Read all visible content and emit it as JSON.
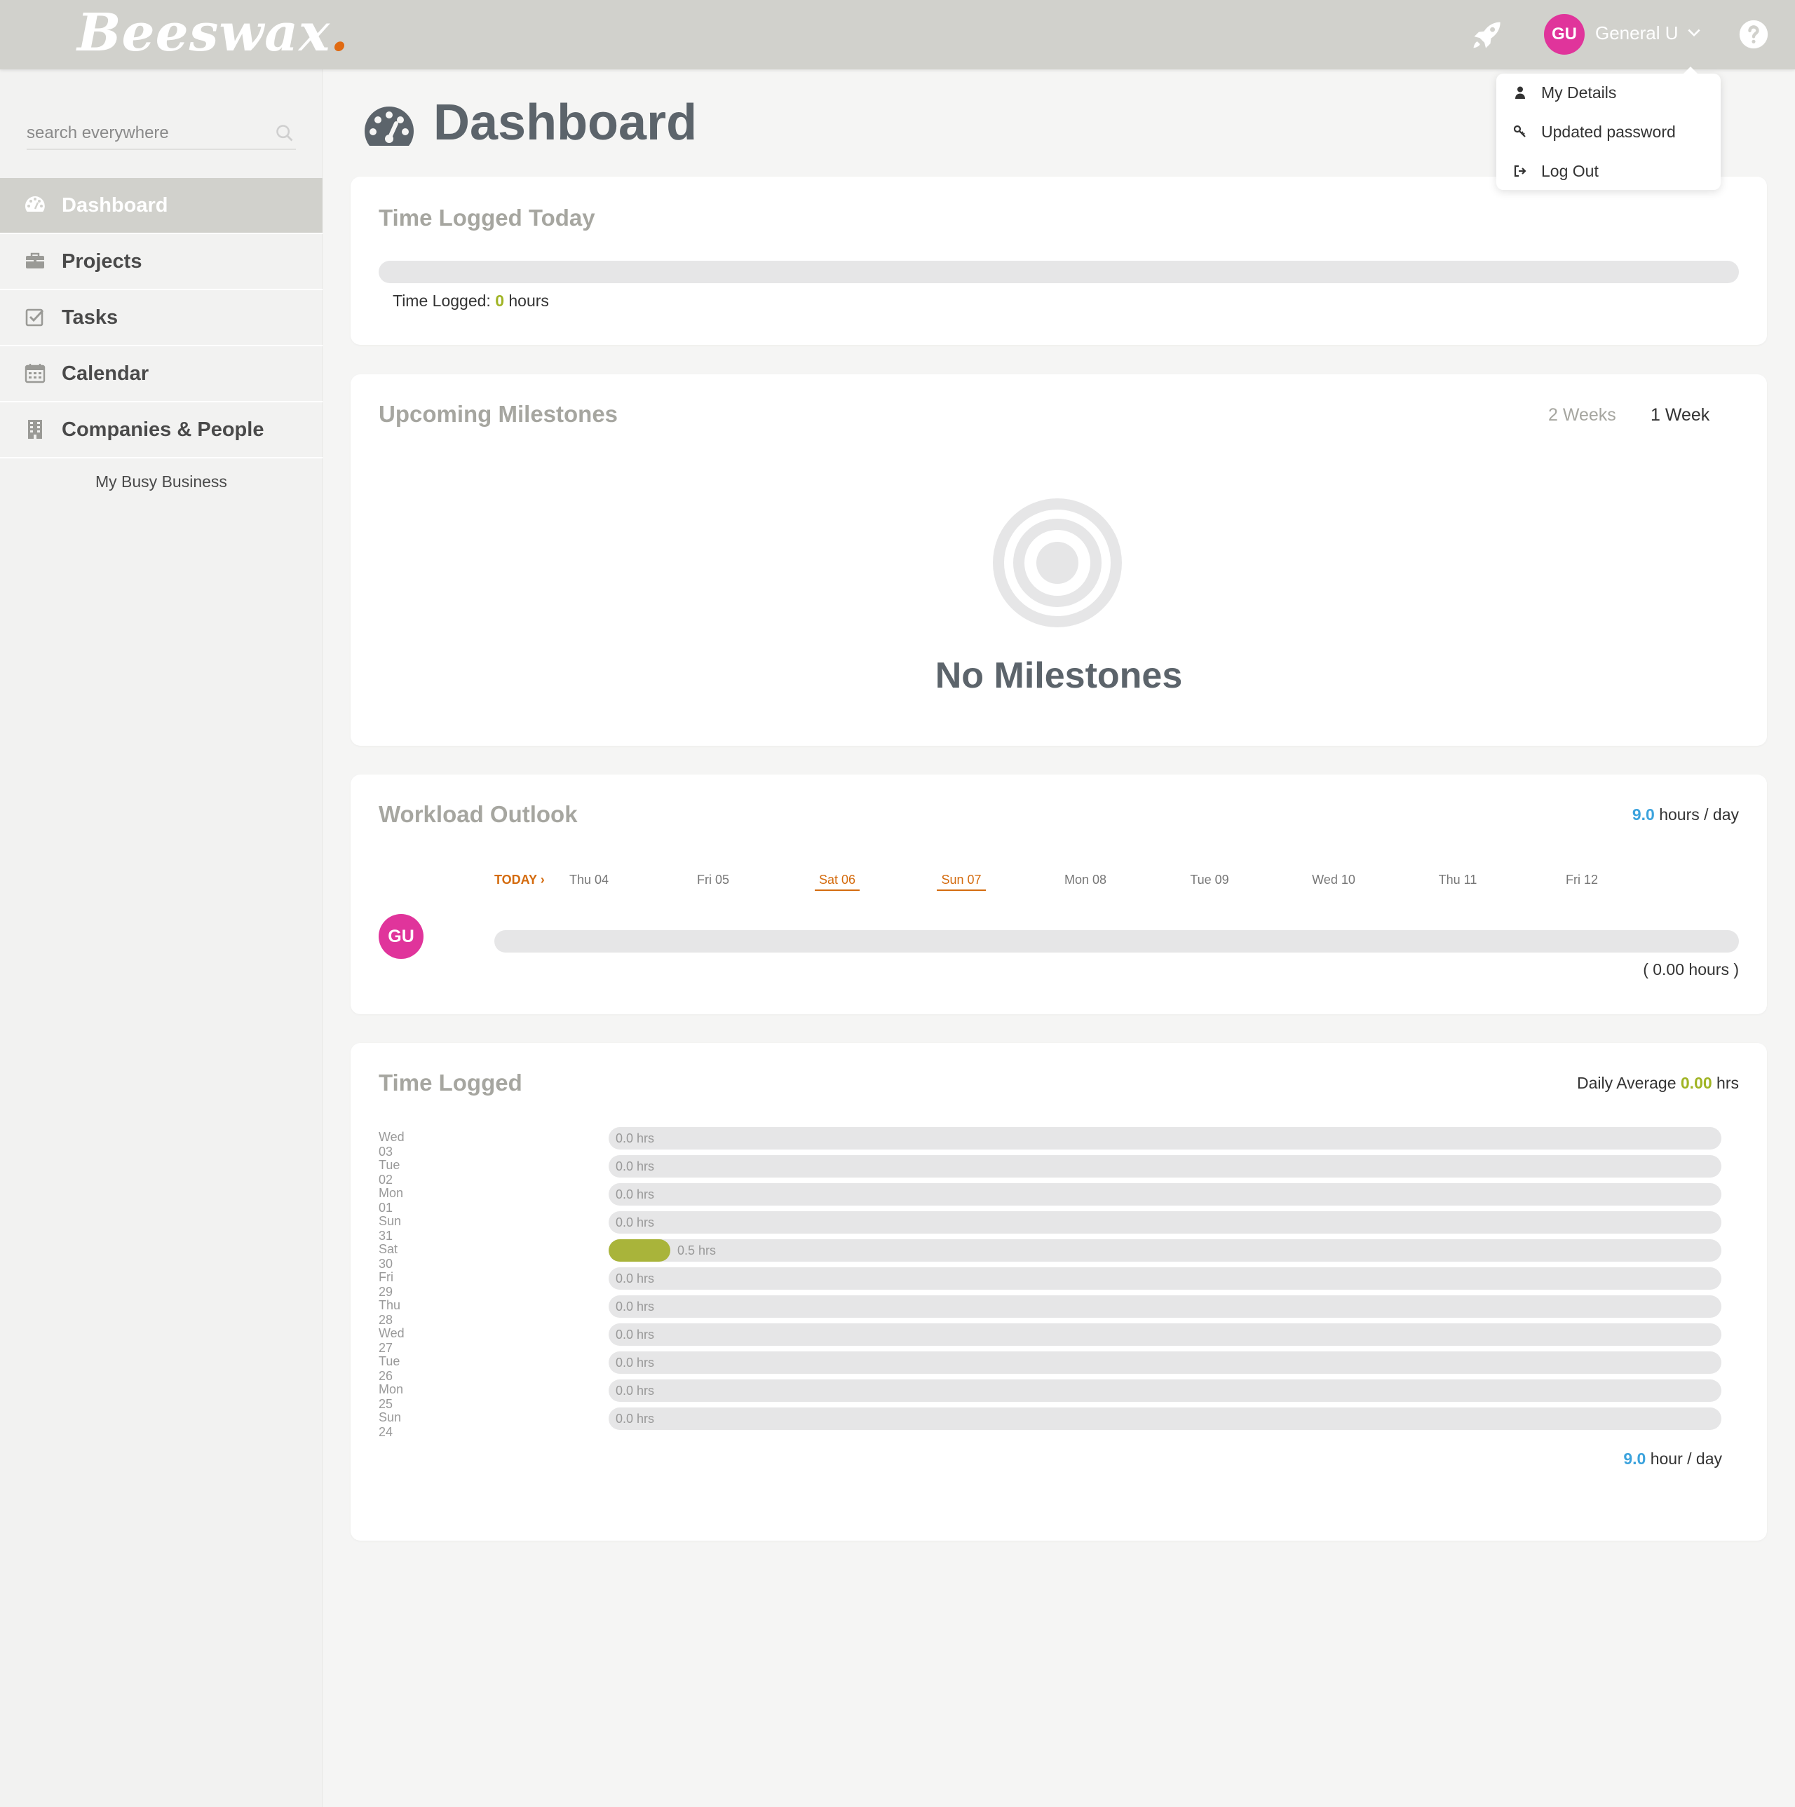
{
  "app": {
    "logo_text": "Beeswax",
    "logo_dot": "."
  },
  "topbar": {
    "user_initials": "GU",
    "user_name": "General U",
    "icons": [
      "rocket-icon",
      "chevron-down-icon",
      "help-icon"
    ]
  },
  "user_menu": {
    "items": [
      {
        "label": "My Details",
        "icon": "user-icon"
      },
      {
        "label": "Updated password",
        "icon": "key-icon"
      },
      {
        "label": "Log Out",
        "icon": "logout-icon"
      }
    ]
  },
  "sidebar": {
    "search_placeholder": "search everywhere",
    "items": [
      {
        "label": "Dashboard",
        "icon": "dashboard-icon",
        "active": true
      },
      {
        "label": "Projects",
        "icon": "briefcase-icon",
        "active": false
      },
      {
        "label": "Tasks",
        "icon": "checkbox-icon",
        "active": false
      },
      {
        "label": "Calendar",
        "icon": "calendar-icon",
        "active": false
      },
      {
        "label": "Companies & People",
        "icon": "building-icon",
        "active": false
      }
    ],
    "sub_item": "My Busy Business"
  },
  "page": {
    "title": "Dashboard"
  },
  "time_logged_today": {
    "title": "Time Logged Today",
    "label": "Time Logged:",
    "value": "0",
    "unit": "hours",
    "progress_fraction": 0
  },
  "milestones": {
    "title": "Upcoming Milestones",
    "ranges": [
      {
        "label": "2 Weeks",
        "selected": false
      },
      {
        "label": "1 Week",
        "selected": true
      }
    ],
    "empty_text": "No Milestones"
  },
  "workload": {
    "title": "Workload Outlook",
    "capacity_value": "9.0",
    "capacity_unit": "hours / day",
    "today_label": "TODAY",
    "days": [
      {
        "label": "Thu 04",
        "weekend": false
      },
      {
        "label": "Fri 05",
        "weekend": false
      },
      {
        "label": "Sat 06",
        "weekend": true
      },
      {
        "label": "Sun 07",
        "weekend": true
      },
      {
        "label": "Mon 08",
        "weekend": false
      },
      {
        "label": "Tue 09",
        "weekend": false
      },
      {
        "label": "Wed 10",
        "weekend": false
      },
      {
        "label": "Thu 11",
        "weekend": false
      },
      {
        "label": "Fri 12",
        "weekend": false
      }
    ],
    "user_initials": "GU",
    "total": "( 0.00 hours )"
  },
  "time_logged": {
    "title": "Time Logged",
    "avg_label": "Daily Average",
    "avg_value": "0.00",
    "avg_unit": "hrs",
    "capacity_value": "9.0",
    "capacity_unit": "hour / day",
    "colors": {
      "fill": "#a9b43a",
      "track": "#e6e6e7"
    },
    "rows": [
      {
        "day": "Wed 03",
        "hours": 0.0,
        "label": "0.0 hrs"
      },
      {
        "day": "Tue 02",
        "hours": 0.0,
        "label": "0.0 hrs"
      },
      {
        "day": "Mon 01",
        "hours": 0.0,
        "label": "0.0 hrs"
      },
      {
        "day": "Sun 31",
        "hours": 0.0,
        "label": "0.0 hrs"
      },
      {
        "day": "Sat 30",
        "hours": 0.5,
        "label": "0.5 hrs"
      },
      {
        "day": "Fri 29",
        "hours": 0.0,
        "label": "0.0 hrs"
      },
      {
        "day": "Thu 28",
        "hours": 0.0,
        "label": "0.0 hrs"
      },
      {
        "day": "Wed 27",
        "hours": 0.0,
        "label": "0.0 hrs"
      },
      {
        "day": "Tue 26",
        "hours": 0.0,
        "label": "0.0 hrs"
      },
      {
        "day": "Mon 25",
        "hours": 0.0,
        "label": "0.0 hrs"
      },
      {
        "day": "Sun 24",
        "hours": 0.0,
        "label": "0.0 hrs"
      }
    ],
    "max_hours": 9.0
  }
}
